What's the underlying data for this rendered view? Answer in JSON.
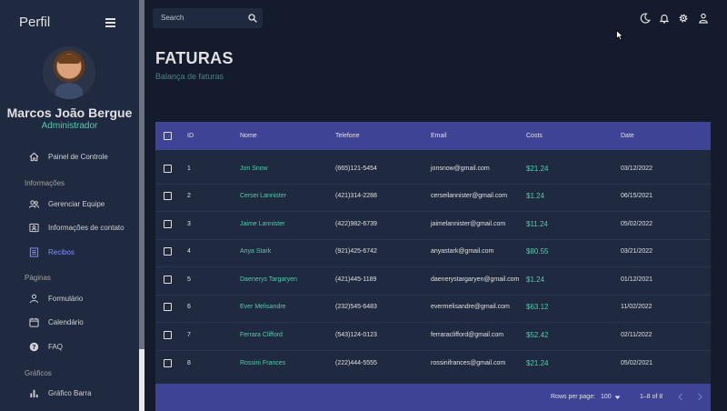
{
  "sidebar": {
    "brand": "Perfil",
    "user_name": "Marcos João Bergue",
    "user_role": "Administrador",
    "items": [
      {
        "label": "Painel de Controle",
        "icon": "home-icon"
      },
      {
        "label": "Gerenciar Equipe",
        "icon": "people-icon"
      },
      {
        "label": "Informações de contato",
        "icon": "contacts-icon"
      },
      {
        "label": "Recibos",
        "icon": "receipt-icon"
      },
      {
        "label": "Formulário",
        "icon": "person-icon"
      },
      {
        "label": "Calendário",
        "icon": "calendar-icon"
      },
      {
        "label": "FAQ",
        "icon": "help-icon"
      },
      {
        "label": "Gráfico Barra",
        "icon": "bar-chart-icon"
      }
    ],
    "sections": [
      "Informações",
      "Páginas",
      "Gráficos"
    ],
    "active_color": "#868dfb"
  },
  "topbar": {
    "search_placeholder": "Search",
    "icons": [
      "search-icon",
      "dark-mode-icon",
      "notifications-icon",
      "settings-icon",
      "account-icon"
    ]
  },
  "header": {
    "title": "FATURAS",
    "subtitle": "Balança de faturas"
  },
  "table": {
    "columns": [
      "ID",
      "Nome",
      "Telefone",
      "Email",
      "Costs",
      "Date"
    ],
    "rows": [
      {
        "id": "1",
        "name": "Jon Snow",
        "phone": "(665)121-5454",
        "email": "jonsnow@gmail.com",
        "cost": "$21.24",
        "date": "03/12/2022"
      },
      {
        "id": "2",
        "name": "Cersei Lannister",
        "phone": "(421)314-2288",
        "email": "cerseilannister@gmail.com",
        "cost": "$1.24",
        "date": "06/15/2021"
      },
      {
        "id": "3",
        "name": "Jaime Lannister",
        "phone": "(422)982-6739",
        "email": "jaimelannister@gmail.com",
        "cost": "$11.24",
        "date": "05/02/2022"
      },
      {
        "id": "4",
        "name": "Anya Stark",
        "phone": "(921)425-6742",
        "email": "anyastark@gmail.com",
        "cost": "$80.55",
        "date": "03/21/2022"
      },
      {
        "id": "5",
        "name": "Daenerys Targaryen",
        "phone": "(421)445-1189",
        "email": "daenerystargaryen@gmail.com",
        "cost": "$1.24",
        "date": "01/12/2021"
      },
      {
        "id": "6",
        "name": "Ever Melisandre",
        "phone": "(232)545-6483",
        "email": "evermelisandre@gmail.com",
        "cost": "$63.12",
        "date": "11/02/2022"
      },
      {
        "id": "7",
        "name": "Ferrara Clifford",
        "phone": "(543)124-0123",
        "email": "ferraraclifford@gmail.com",
        "cost": "$52.42",
        "date": "02/11/2022"
      },
      {
        "id": "8",
        "name": "Rossini Frances",
        "phone": "(222)444-5555",
        "email": "rossinifrances@gmail.com",
        "cost": "$21.24",
        "date": "05/02/2021"
      }
    ],
    "footer": {
      "rows_per_page_label": "Rows per page:",
      "rows_per_page_value": "100",
      "range": "1–8 of 8"
    },
    "header_color": "#3e4396",
    "accent_color": "#4cceac"
  }
}
